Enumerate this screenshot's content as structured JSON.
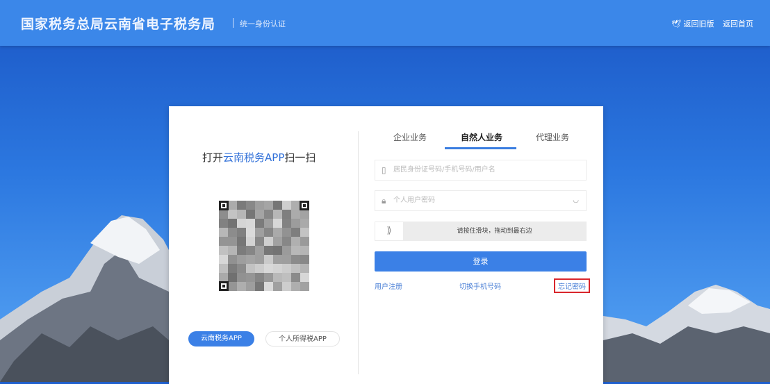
{
  "header": {
    "title": "国家税务总局云南省电子税务局",
    "subtitle": "统一身份认证",
    "links": [
      {
        "label": "返回旧版",
        "icon": "bird-icon"
      },
      {
        "label": "返回首页"
      }
    ]
  },
  "qr_panel": {
    "scan_prefix": "打开",
    "scan_app": "云南税务APP",
    "scan_suffix": "扫一扫",
    "buttons": [
      "云南税务APP",
      "个人所得税APP"
    ]
  },
  "login": {
    "tabs": [
      {
        "label": "企业业务",
        "active": false
      },
      {
        "label": "自然人业务",
        "active": true
      },
      {
        "label": "代理业务",
        "active": false
      }
    ],
    "account_placeholder": "居民身份证号码/手机号码/用户名",
    "password_placeholder": "个人用户密码",
    "slider_text": "请按住滑块，拖动到最右边",
    "submit": "登录",
    "links": [
      "用户注册",
      "切换手机号码",
      "忘记密码"
    ],
    "highlight_color": "#d9262c"
  }
}
